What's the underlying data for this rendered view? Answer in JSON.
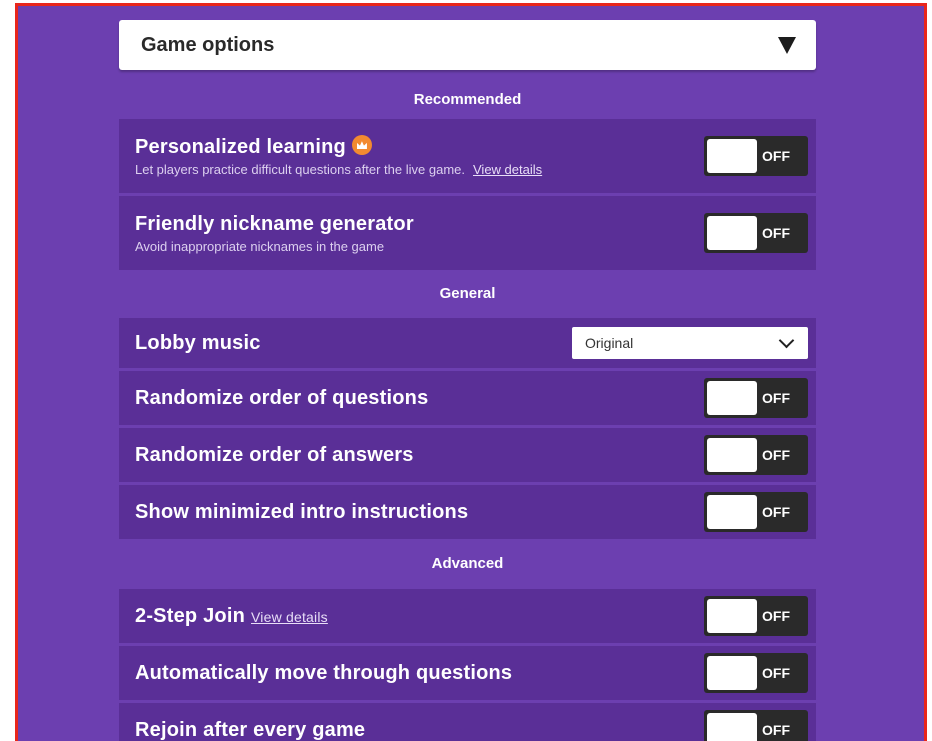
{
  "header": {
    "title": "Game options"
  },
  "sections": {
    "recommended": {
      "title": "Recommended"
    },
    "general": {
      "title": "General"
    },
    "advanced": {
      "title": "Advanced"
    }
  },
  "options": {
    "personalized_learning": {
      "label": "Personalized learning",
      "description": "Let players practice difficult questions after the live game.",
      "link": "View details",
      "state": "OFF"
    },
    "nickname_generator": {
      "label": "Friendly nickname generator",
      "description": "Avoid inappropriate nicknames in the game",
      "state": "OFF"
    },
    "lobby_music": {
      "label": "Lobby music",
      "value": "Original"
    },
    "randomize_questions": {
      "label": "Randomize order of questions",
      "state": "OFF"
    },
    "randomize_answers": {
      "label": "Randomize order of answers",
      "state": "OFF"
    },
    "minimized_intro": {
      "label": "Show minimized intro instructions",
      "state": "OFF"
    },
    "two_step_join": {
      "label": "2-Step Join",
      "link": "View details",
      "state": "OFF"
    },
    "auto_move": {
      "label": "Automatically move through questions",
      "state": "OFF"
    },
    "rejoin": {
      "label": "Rejoin after every game",
      "state": "OFF"
    }
  },
  "colors": {
    "background": "#6c3fb0",
    "row": "#5a2f97",
    "toggle_off": "#2a2a2a",
    "premium_badge": "#f28a30",
    "frame_border": "#e8261c"
  },
  "icons": {
    "header_caret": "caret-down-icon",
    "premium_badge": "crown-icon",
    "select_chevron": "chevron-down-icon"
  }
}
